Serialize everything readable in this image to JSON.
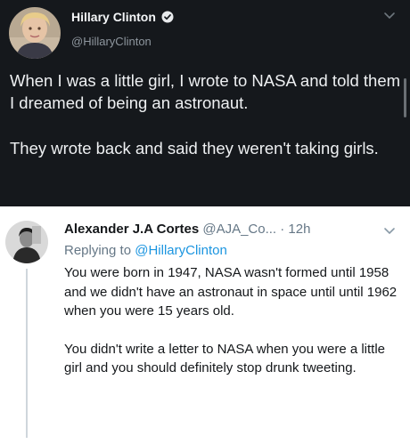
{
  "original_tweet": {
    "author_name": "Hillary Clinton",
    "handle": "@HillaryClinton",
    "verified_icon": "verified-badge-icon",
    "paragraphs": [
      "When I was a little girl, I wrote to NASA and told them I dreamed of being an astronaut.",
      "They wrote back and said they weren't taking girls."
    ]
  },
  "reply_tweet": {
    "author_name": "Alexander J.A Cortes",
    "handle_time": "@AJA_Co... · 12h",
    "replying_prefix": "Replying to",
    "replying_mention": "@HillaryClinton",
    "paragraphs": [
      "You were born in 1947, NASA wasn't formed until 1958 and we didn't have an astronaut in space until until 1962 when you were 15 years old.",
      "You didn't write a letter to NASA when you were a little girl and you should definitely stop drunk tweeting."
    ]
  },
  "colors": {
    "dark_background": "#15181c",
    "link_blue": "#1b95e0",
    "muted_gray": "#657786"
  }
}
